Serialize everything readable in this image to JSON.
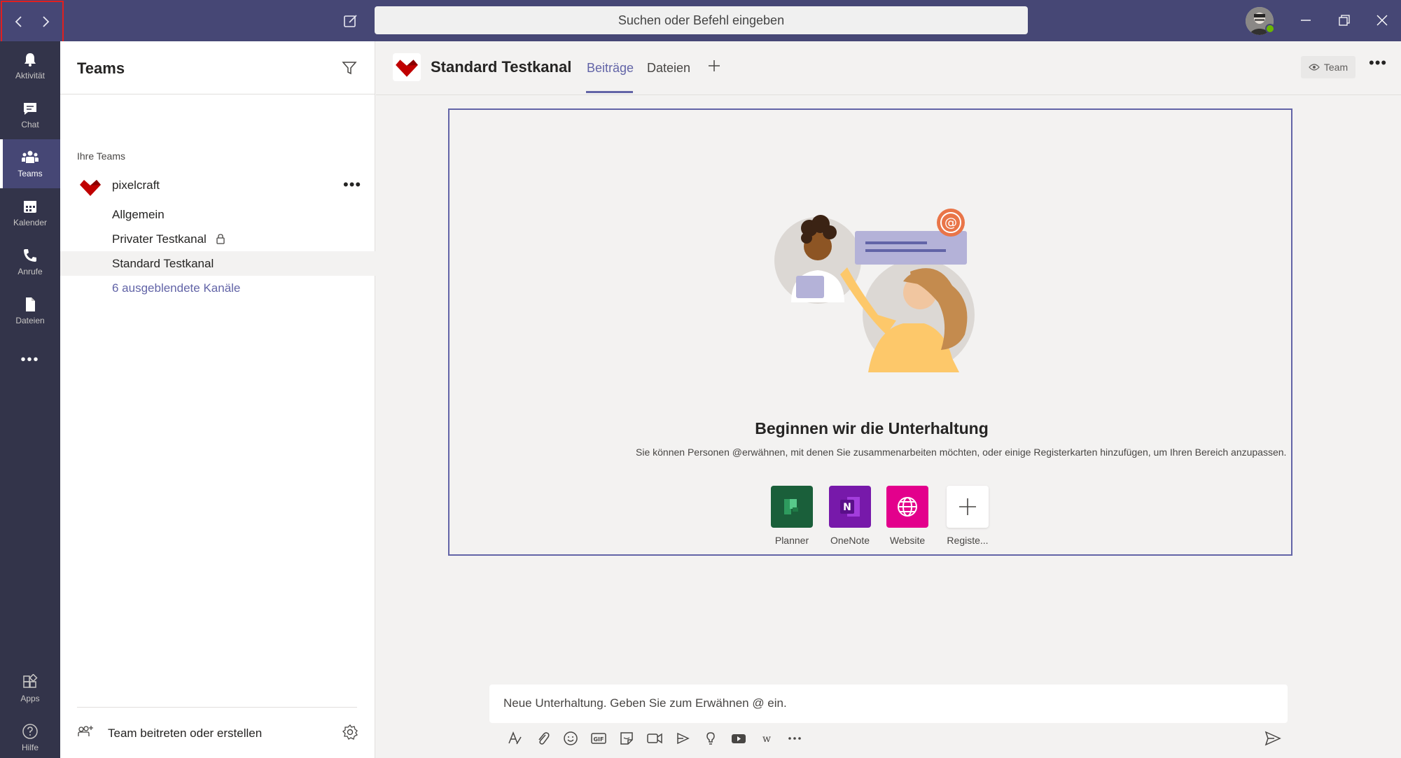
{
  "titlebar": {
    "search_placeholder": "Suchen oder Befehl eingeben",
    "accent_color": "#464775"
  },
  "rail": {
    "items": [
      {
        "label": "Aktivität",
        "icon": "bell-icon"
      },
      {
        "label": "Chat",
        "icon": "chat-icon"
      },
      {
        "label": "Teams",
        "icon": "teams-icon",
        "active": true
      },
      {
        "label": "Kalender",
        "icon": "calendar-icon"
      },
      {
        "label": "Anrufe",
        "icon": "phone-icon"
      },
      {
        "label": "Dateien",
        "icon": "file-icon"
      }
    ],
    "more": "•••",
    "apps_label": "Apps",
    "help_label": "Hilfe"
  },
  "panel": {
    "title": "Teams",
    "section_label": "Ihre Teams",
    "team_name": "pixelcraft",
    "team_more": "•••",
    "channels": [
      {
        "label": "Allgemein"
      },
      {
        "label": "Privater Testkanal",
        "private": true
      },
      {
        "label": "Standard Testkanal",
        "active": true
      },
      {
        "label": "6 ausgeblendete Kanäle",
        "link": true
      }
    ],
    "join_label": "Team beitreten oder erstellen"
  },
  "main": {
    "channel_title": "Standard Testkanal",
    "tabs": [
      {
        "label": "Beiträge",
        "active": true
      },
      {
        "label": "Dateien"
      }
    ],
    "team_pill": "Team",
    "header_more": "•••",
    "welcome": {
      "title": "Beginnen wir die Unterhaltung",
      "subtitle": "Sie können Personen @erwähnen, mit denen Sie zusammenarbeiten möchten, oder einige Registerkarten hinzufügen, um Ihren Bereich anzupassen.",
      "apps": [
        {
          "label": "Planner",
          "color": "#1a5f3a"
        },
        {
          "label": "OneNote",
          "color": "#7719aa"
        },
        {
          "label": "Website",
          "color": "#e3008c"
        },
        {
          "label": "Registe...",
          "color": "#ffffff"
        }
      ]
    },
    "composer_placeholder": "Neue Unterhaltung. Geben Sie zum Erwähnen @ ein."
  }
}
